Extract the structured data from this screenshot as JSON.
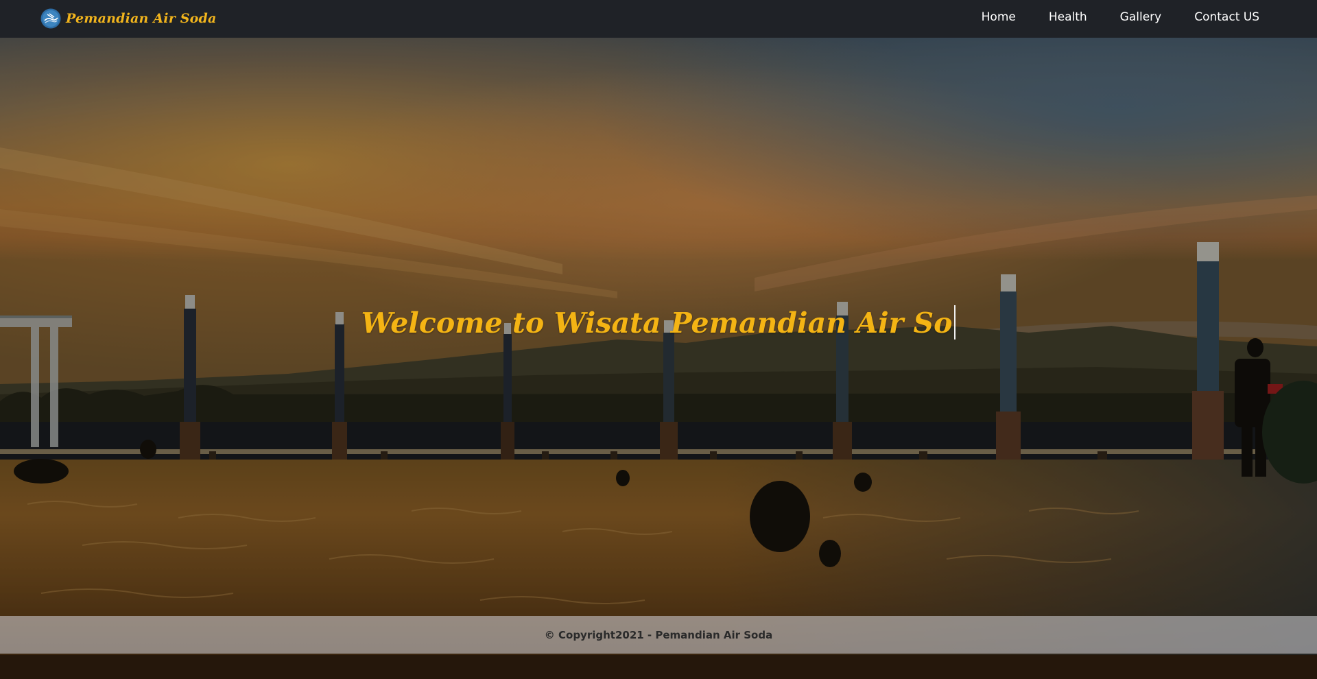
{
  "navbar": {
    "brand_text": "Pemandian Air Soda",
    "links": [
      {
        "label": "Home"
      },
      {
        "label": "Health"
      },
      {
        "label": "Gallery"
      },
      {
        "label": "Contact US"
      }
    ]
  },
  "hero": {
    "title": "Welcome to Wisata Pemandian Air So",
    "image_icon": "sunset-pool-photo"
  },
  "footer": {
    "copyright": "© Copyright2021 - Pemandian Air Soda"
  },
  "colors": {
    "navbar_bg": "#1f2227",
    "brand_accent": "#f2b51d",
    "hero_title": "#f4b414",
    "nav_text": "#ffffff",
    "footer_text": "#2a2a2a"
  }
}
